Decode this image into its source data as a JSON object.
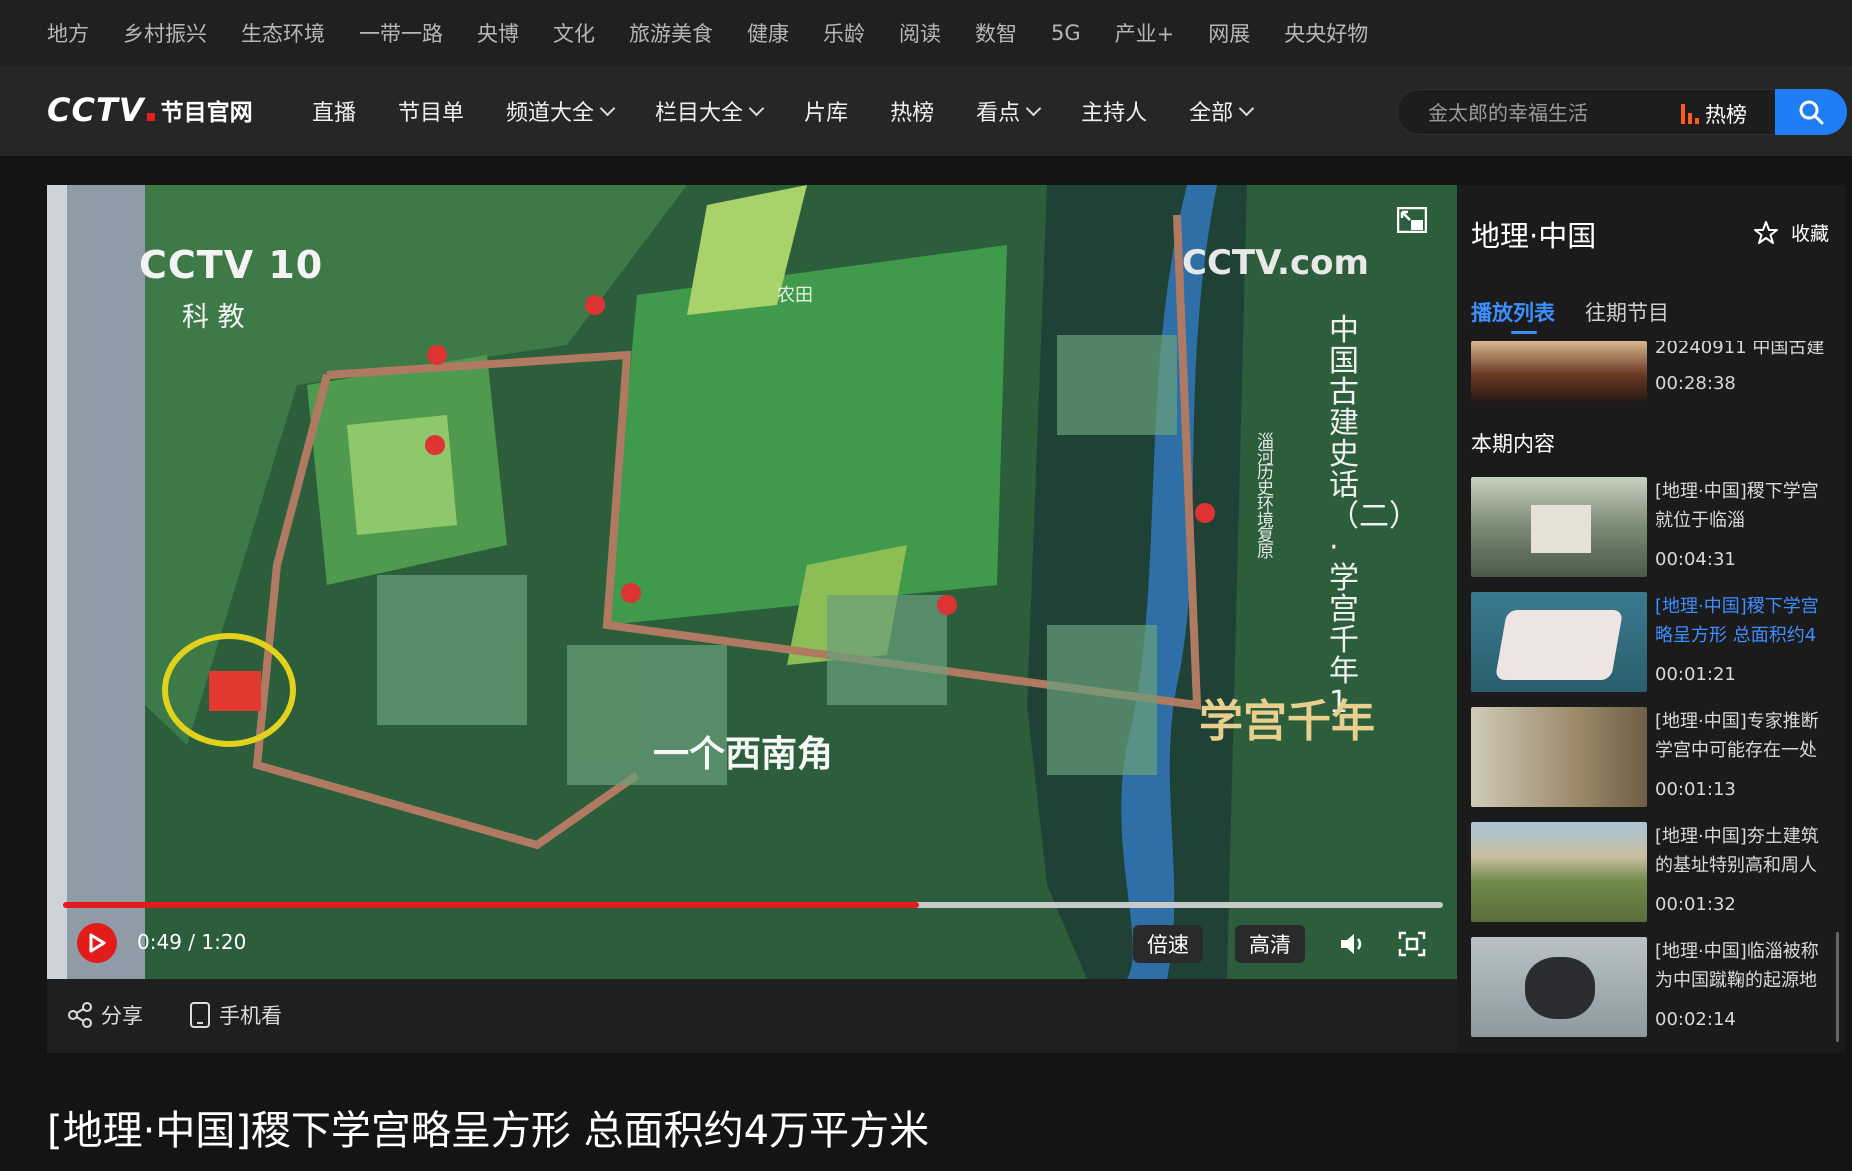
{
  "top_categories": [
    "地方",
    "乡村振兴",
    "生态环境",
    "一带一路",
    "央博",
    "文化",
    "旅游美食",
    "健康",
    "乐龄",
    "阅读",
    "数智",
    "5G",
    "产业+",
    "网展",
    "央央好物"
  ],
  "logo": {
    "brand": "CCTV",
    "sub": "节目官网"
  },
  "nav": {
    "live": "直播",
    "schedule": "节目单",
    "channels": "频道大全",
    "columns": "栏目大全",
    "library": "片库",
    "hot_list": "热榜",
    "highlights": "看点",
    "hosts": "主持人",
    "all": "全部"
  },
  "search": {
    "placeholder": "金太郎的幸福生活",
    "hot_label": "热榜"
  },
  "player": {
    "channel_logo": "CCTV 10",
    "channel_sub": "科 教",
    "site_watermark": "CCTV.com",
    "vertical_title": "中国古建史话（二）· 学宫千年 1",
    "vertical_subtitle": "淄 河 历 史 环 境 复 原",
    "subtitle": "一个西南角",
    "program_seal": "学宫千年",
    "map_label_farm": "农田",
    "time_current": "0:49",
    "time_total": "1:20",
    "time_sep": " / ",
    "progress": 0.62,
    "speed_label": "倍速",
    "quality_label": "高清"
  },
  "below_player": {
    "share": "分享",
    "mobile": "手机看"
  },
  "side": {
    "title": "地理·中国",
    "fav_label": "收藏",
    "tabs": [
      "播放列表",
      "往期节目"
    ],
    "prev_item": {
      "title": "20240911 中国古建",
      "duration": "00:28:38"
    },
    "section_label": "本期内容",
    "items": [
      {
        "title": "[地理·中国]稷下学宫就位于临淄",
        "duration": "00:04:31"
      },
      {
        "title": "[地理·中国]稷下学宫略呈方形 总面积约4",
        "duration": "00:01:21"
      },
      {
        "title": "[地理·中国]专家推断学宫中可能存在一处",
        "duration": "00:01:13"
      },
      {
        "title": "[地理·中国]夯土建筑的基址特别高和周人",
        "duration": "00:01:32"
      },
      {
        "title": "[地理·中国]临淄被称为中国蹴鞠的起源地",
        "duration": "00:02:14"
      }
    ]
  },
  "page_title": "[地理·中国]稷下学宫略呈方形 总面积约4万平方米",
  "colors": {
    "accent": "#1f7ef6",
    "active_text": "#3d8eff",
    "progress": "#e21b1b",
    "hot": "#ff5a1f"
  }
}
